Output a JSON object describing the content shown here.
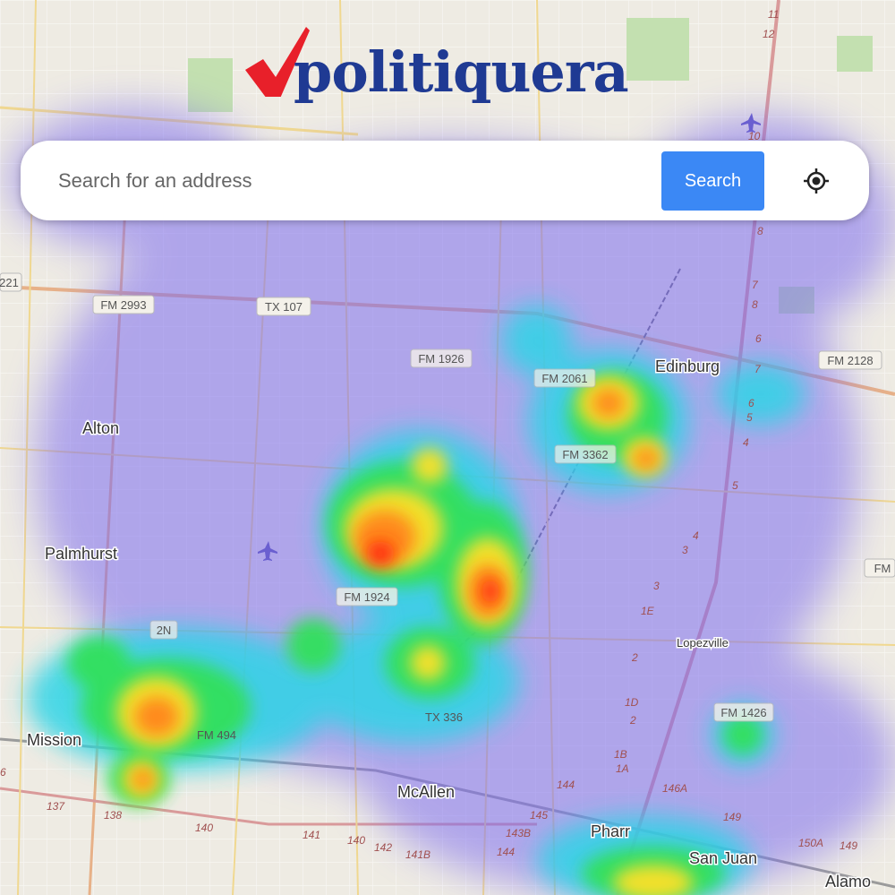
{
  "app": {
    "logo_text": "politiquera",
    "brand_color": "#1f3a93",
    "check_color": "#e8202a"
  },
  "search": {
    "placeholder": "Search for an address",
    "button_label": "Search",
    "locate_icon": "crosshair-icon"
  },
  "map": {
    "places": [
      "Edinburg",
      "Alton",
      "Palmhurst",
      "Mission",
      "McAllen",
      "Pharr",
      "San Juan",
      "Alamo",
      "Lopezville"
    ],
    "road_shields": [
      "FM 2993",
      "TX 107",
      "FM 1926",
      "FM 2061",
      "FM 2128",
      "FM 3362",
      "FM 1924",
      "2N",
      "FM 494",
      "TX 336",
      "FM 1426",
      "FM",
      "221"
    ],
    "route_numbers": [
      "11",
      "12",
      "10",
      "8",
      "7",
      "8",
      "6",
      "7",
      "6",
      "5",
      "4",
      "5",
      "4",
      "3",
      "3",
      "2",
      "1E",
      "1D",
      "1B",
      "1A",
      "2",
      "146A",
      "149",
      "150A",
      "149",
      "144",
      "145",
      "143B",
      "144",
      "142",
      "141B",
      "140",
      "141",
      "140",
      "138",
      "137",
      "6"
    ],
    "heat_colors": [
      "#7d6cf0",
      "#2fd4e6",
      "#33e05c",
      "#f2e02a",
      "#ff8a1c",
      "#ff2a10"
    ]
  }
}
